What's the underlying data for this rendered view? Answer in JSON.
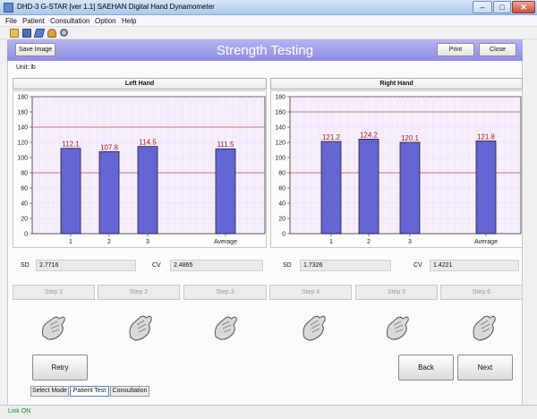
{
  "window": {
    "title": "DHD-3 G-STAR [ver 1.1] SAEHAN Digital Hand Dynamometer",
    "buttons": {
      "minimize": "–",
      "maximize": "□",
      "close": "✕"
    }
  },
  "menu": [
    "File",
    "Patient",
    "Consultation",
    "Option",
    "Help"
  ],
  "toolbar_icons": [
    "open-icon",
    "save-icon",
    "edit-icon",
    "user-icon",
    "search-icon"
  ],
  "header": {
    "title": "Strength Testing",
    "save_image": "Save Image",
    "print": "Print",
    "close": "Close",
    "color": "#9a97ea"
  },
  "unit_label": "Unit: lb",
  "left": {
    "heading": "Left Hand",
    "sd_label": "SD",
    "sd_value": "2.7716",
    "cv_label": "CV",
    "cv_value": "2.4865"
  },
  "right": {
    "heading": "Right Hand",
    "sd_label": "SD",
    "sd_value": "1.7326",
    "cv_label": "CV",
    "cv_value": "1.4221"
  },
  "steps": [
    "Step 1",
    "Step 2",
    "Step 3",
    "Step 4",
    "Step 5",
    "Step 6"
  ],
  "buttons": {
    "retry": "Retry",
    "back": "Back",
    "next": "Next"
  },
  "mode_tabs": [
    "Select Mode",
    "Patient Test",
    "Consultation"
  ],
  "status": "Link ON",
  "chart_data": [
    {
      "type": "bar",
      "categories": [
        "1",
        "2",
        "3",
        "Average"
      ],
      "values": [
        112.1,
        107.8,
        114.5,
        111.5
      ],
      "ylim": [
        0,
        180
      ],
      "yticks": [
        0,
        20,
        40,
        60,
        80,
        100,
        120,
        140,
        160,
        180
      ],
      "reference_lines": [
        140,
        80
      ],
      "bar_color": "#6464d4",
      "label_color": "#b01818",
      "grid": true
    },
    {
      "type": "bar",
      "categories": [
        "1",
        "2",
        "3",
        "Average"
      ],
      "values": [
        121.2,
        124.2,
        120.1,
        121.8
      ],
      "ylim": [
        0,
        180
      ],
      "yticks": [
        0,
        20,
        40,
        60,
        80,
        100,
        120,
        140,
        160,
        180
      ],
      "reference_lines": [
        160,
        80
      ],
      "bar_color": "#6464d4",
      "label_color": "#b01818",
      "grid": true
    }
  ]
}
